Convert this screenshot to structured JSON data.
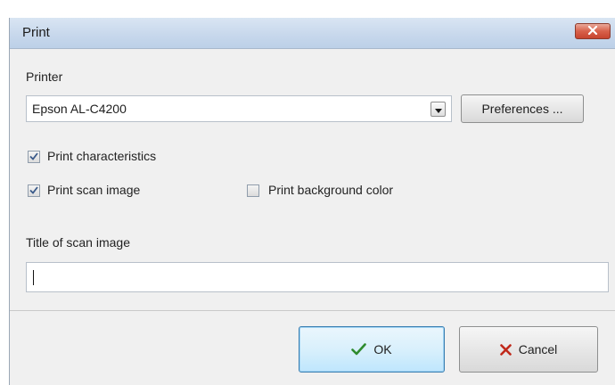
{
  "dialog": {
    "title": "Print",
    "close_icon": "close-icon"
  },
  "printer": {
    "label": "Printer",
    "selected": "Epson AL-C4200",
    "preferences_label": "Preferences ..."
  },
  "options": {
    "print_characteristics": {
      "label": "Print characteristics",
      "checked": true
    },
    "print_scan_image": {
      "label": "Print scan image",
      "checked": true
    },
    "print_background_color": {
      "label": "Print background color",
      "checked": false
    }
  },
  "title_field": {
    "label": "Title of scan image",
    "value": ""
  },
  "buttons": {
    "ok_label": "OK",
    "cancel_label": "Cancel"
  },
  "colors": {
    "ok_check": "#2e8b2e",
    "cancel_x": "#c0281a",
    "close_button": "#c7442f"
  }
}
